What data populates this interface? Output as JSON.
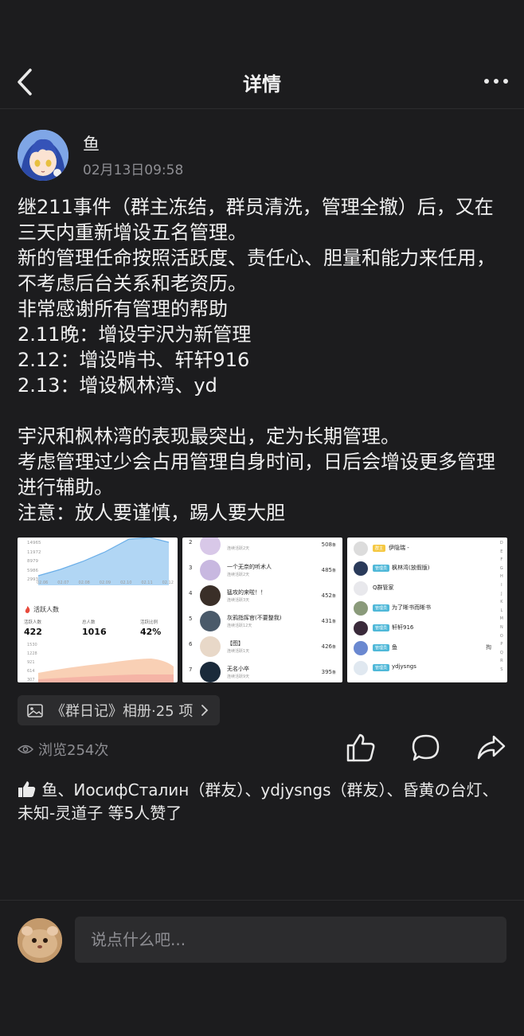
{
  "header": {
    "title": "详情"
  },
  "post": {
    "author": "鱼",
    "time": "02月13日09:58",
    "paragraphs": [
      "继211事件（群主冻结，群员清洗，管理全撤）后，又在三天内重新增设五名管理。\n新的管理任命按照活跃度、责任心、胆量和能力来任用，不考虑后台关系和老资历。\n非常感谢所有管理的帮助\n2.11晚：增设宇沢为新管理\n2.12：增设啃书、轩轩916\n2.13：增设枫林湾、yd",
      "宇沢和枫林湾的表现最突出，定为长期管理。\n考虑管理过少会占用管理自身时间，日后会增设更多管理进行辅助。\n注意：放人要谨慎，踢人要大胆"
    ]
  },
  "thumb1": {
    "y_ticks": [
      "14965",
      "11972",
      "8979",
      "5986",
      "2993"
    ],
    "x_ticks": [
      "02.06",
      "02.07",
      "02.08",
      "02.09",
      "02.10",
      "02.11",
      "02.12"
    ],
    "section_title": "活跃人数",
    "stats": [
      {
        "label": "活跃人数",
        "value": "422"
      },
      {
        "label": "总人数",
        "value": "1016"
      },
      {
        "label": "活跃比例",
        "value": "42%"
      }
    ],
    "y_ticks2": [
      "1530",
      "1228",
      "921",
      "614",
      "307"
    ],
    "colors": {
      "area_top": "#a8d1f3",
      "area_bottom": "#f8c8a8"
    }
  },
  "thumb2": {
    "rows": [
      {
        "rank": "2",
        "name": "",
        "sub": "连续活跃2天",
        "count": "508"
      },
      {
        "rank": "3",
        "name": "一个无奈的听术人",
        "sub": "连续活跃2天",
        "count": "485"
      },
      {
        "rank": "4",
        "name": "猛攻的来啦！！",
        "sub": "连续活跃3天",
        "count": "452"
      },
      {
        "rank": "5",
        "name": "灰鸦指挥官(不要整我)",
        "sub": "连续活跃12天",
        "count": "431"
      },
      {
        "rank": "6",
        "name": "【图】",
        "sub": "连续活跃1天",
        "count": "426"
      },
      {
        "rank": "7",
        "name": "无名小卒",
        "sub": "连续活跃9天",
        "count": "395"
      }
    ],
    "count_unit": "条"
  },
  "thumb3": {
    "members": [
      {
        "badge": "群主",
        "name": "伊隐瑞 -"
      },
      {
        "badge": "管理员",
        "name": "枫林湾(放假版)"
      },
      {
        "badge": "",
        "name": "Q群管家"
      },
      {
        "badge": "管理员",
        "name": "为了晰书而晰书"
      },
      {
        "badge": "管理员",
        "name": "轩轩916"
      },
      {
        "badge": "管理员",
        "name": "鱼"
      },
      {
        "badge": "管理员",
        "name": "ydjysngs"
      }
    ],
    "side_index": [
      "D",
      "E",
      "F",
      "G",
      "H",
      "I",
      "J",
      "K",
      "L",
      "M",
      "N",
      "O",
      "P",
      "Q",
      "R",
      "S"
    ],
    "extra_char": "掏"
  },
  "album": {
    "label": "《群日记》相册·25 项"
  },
  "views": "浏览254次",
  "likes": "鱼、ИосифСталин（群友）、ydjysngs（群友）、昏黄の台灯、未知-灵道子 等5人赞了",
  "comment": {
    "placeholder": "说点什么吧..."
  }
}
